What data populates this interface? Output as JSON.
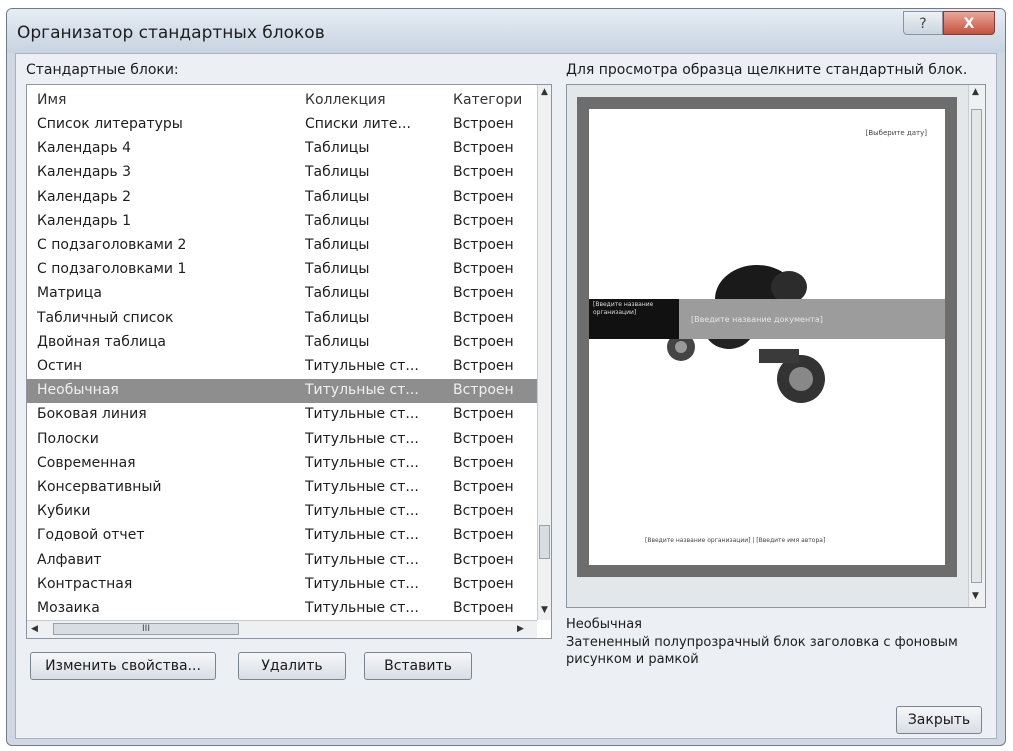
{
  "window": {
    "title": "Организатор стандартных блоков",
    "help_label": "?",
    "close_label": "X"
  },
  "list_panel": {
    "label": "Стандартные блоки:",
    "columns": [
      "Имя",
      "Коллекция",
      "Категори"
    ],
    "rows": [
      {
        "name": "Список литературы",
        "collection": "Списки лите...",
        "category": "Встроен"
      },
      {
        "name": "Календарь 4",
        "collection": "Таблицы",
        "category": "Встроен"
      },
      {
        "name": "Календарь 3",
        "collection": "Таблицы",
        "category": "Встроен"
      },
      {
        "name": "Календарь 2",
        "collection": "Таблицы",
        "category": "Встроен"
      },
      {
        "name": "Календарь 1",
        "collection": "Таблицы",
        "category": "Встроен"
      },
      {
        "name": "С подзаголовками 2",
        "collection": "Таблицы",
        "category": "Встроен"
      },
      {
        "name": "С подзаголовками 1",
        "collection": "Таблицы",
        "category": "Встроен"
      },
      {
        "name": "Матрица",
        "collection": "Таблицы",
        "category": "Встроен"
      },
      {
        "name": "Табличный список",
        "collection": "Таблицы",
        "category": "Встроен"
      },
      {
        "name": "Двойная таблица",
        "collection": "Таблицы",
        "category": "Встроен"
      },
      {
        "name": "Остин",
        "collection": "Титульные ст...",
        "category": "Встроен"
      },
      {
        "name": "Необычная",
        "collection": "Титульные ст...",
        "category": "Встроен"
      },
      {
        "name": "Боковая линия",
        "collection": "Титульные ст...",
        "category": "Встроен"
      },
      {
        "name": "Полоски",
        "collection": "Титульные ст...",
        "category": "Встроен"
      },
      {
        "name": "Современная",
        "collection": "Титульные ст...",
        "category": "Встроен"
      },
      {
        "name": "Консервативный",
        "collection": "Титульные ст...",
        "category": "Встроен"
      },
      {
        "name": "Кубики",
        "collection": "Титульные ст...",
        "category": "Встроен"
      },
      {
        "name": "Годовой отчет",
        "collection": "Титульные ст...",
        "category": "Встроен"
      },
      {
        "name": "Алфавит",
        "collection": "Титульные ст...",
        "category": "Встроен"
      },
      {
        "name": "Контрастная",
        "collection": "Титульные ст...",
        "category": "Встроен"
      },
      {
        "name": "Мозаика",
        "collection": "Титульные ст...",
        "category": "Встроен"
      }
    ],
    "selected_index": 11,
    "hscroll_thumb_label": "III"
  },
  "buttons": {
    "edit": "Изменить свойства...",
    "delete": "Удалить",
    "insert": "Вставить",
    "close": "Закрыть"
  },
  "preview_panel": {
    "label": "Для просмотра образца щелкните стандартный блок.",
    "date_placeholder": "[Выберите дату]",
    "title_placeholder": "[Введите название документа]",
    "black_box_text": "[Введите название организации]",
    "footer_placeholder": "[Введите название организации] | [Введите имя автора]",
    "selected_name": "Необычная",
    "description": "Затененный полупрозрачный блок заголовка с фоновым рисунком и рамкой"
  }
}
